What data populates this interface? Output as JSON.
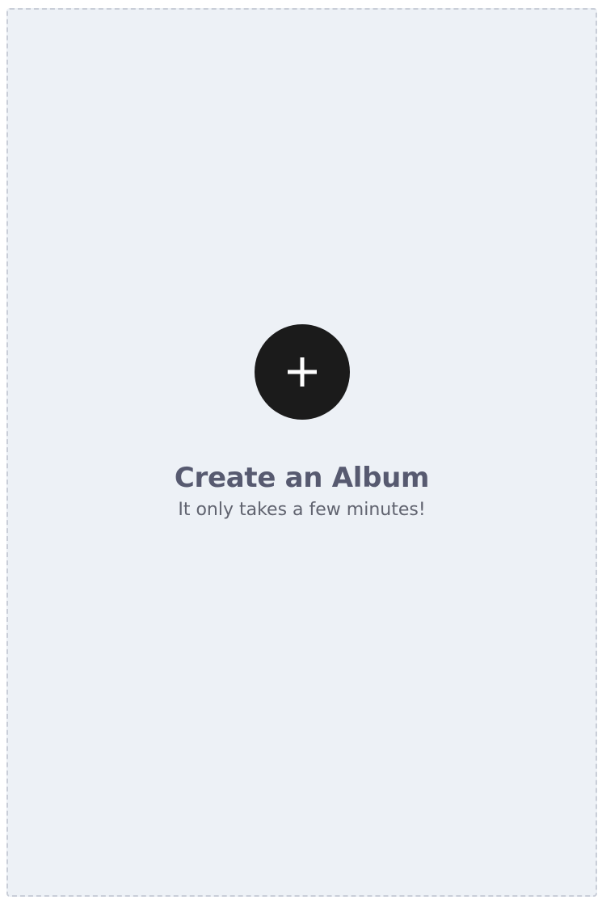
{
  "create_album": {
    "icon": "plus-icon",
    "title": "Create an Album",
    "subtitle": "It only takes a few minutes!"
  },
  "colors": {
    "card_background": "#edf1f6",
    "card_border": "#c9ced8",
    "button_background": "#1b1b1b",
    "icon_color": "#ffffff",
    "title_color": "#575a70",
    "subtitle_color": "#60636f"
  }
}
